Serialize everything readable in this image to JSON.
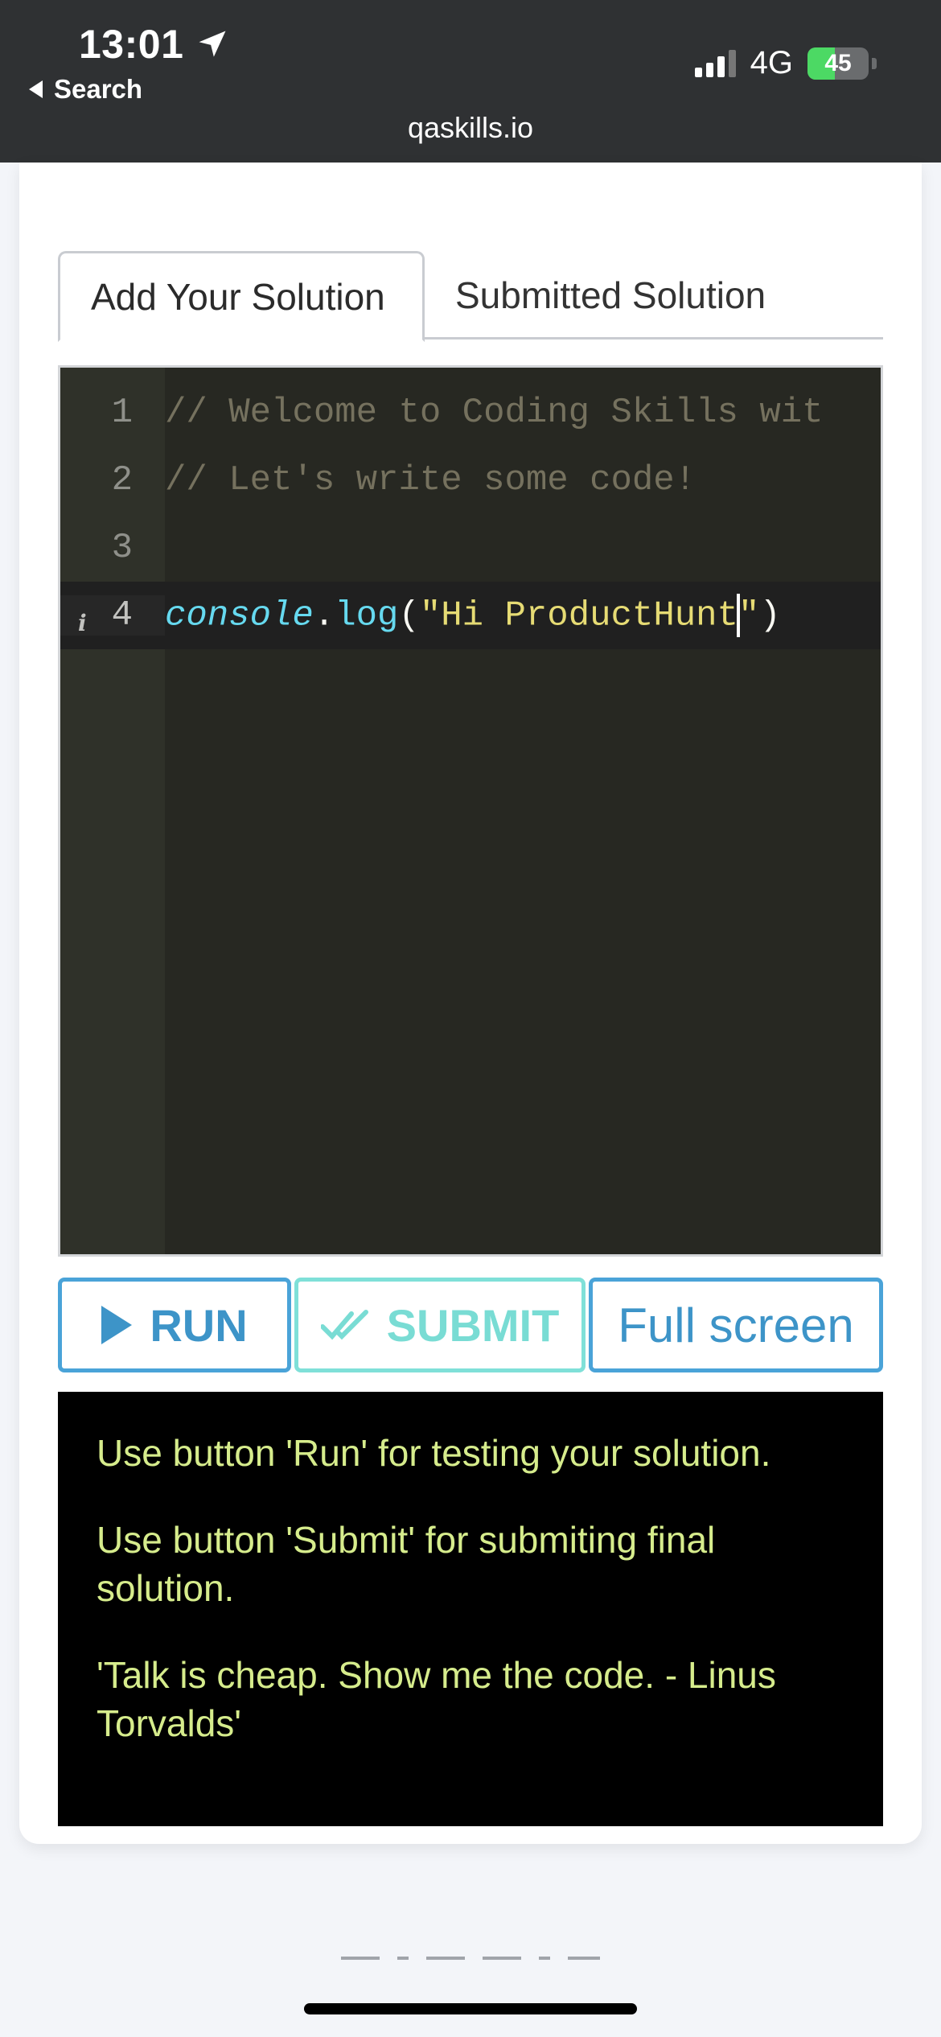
{
  "status_bar": {
    "time": "13:01",
    "back_label": "Search",
    "network": "4G",
    "battery": "45",
    "battery_level": 0.45,
    "url": "qaskills.io"
  },
  "tabs": [
    {
      "label": "Add Your Solution"
    },
    {
      "label": "Submitted Solution"
    }
  ],
  "editor": {
    "lines": [
      {
        "number": "1",
        "text": "// Welcome to Coding Skills wit"
      },
      {
        "number": "2",
        "text": "// Let's write some code!"
      },
      {
        "number": "3",
        "text": ""
      },
      {
        "number": "4",
        "obj": "console",
        "dot": ".",
        "fn": "log",
        "open": "(",
        "str_before_caret": "\"Hi ProductHunt",
        "str_after_caret": "\"",
        "close": ")"
      }
    ]
  },
  "buttons": {
    "run": "RUN",
    "submit": "SUBMIT",
    "fullscreen": "Full screen"
  },
  "console": {
    "messages": [
      "Use button 'Run' for testing your solution.",
      "Use button 'Submit' for submiting final solution.",
      "'Talk is cheap. Show me the code. - Linus Torvalds'"
    ]
  },
  "colors": {
    "accent_blue": "#3d94c8",
    "accent_teal": "#79dcd4",
    "console_text": "#d6ec8c",
    "editor_bg": "#272822"
  }
}
